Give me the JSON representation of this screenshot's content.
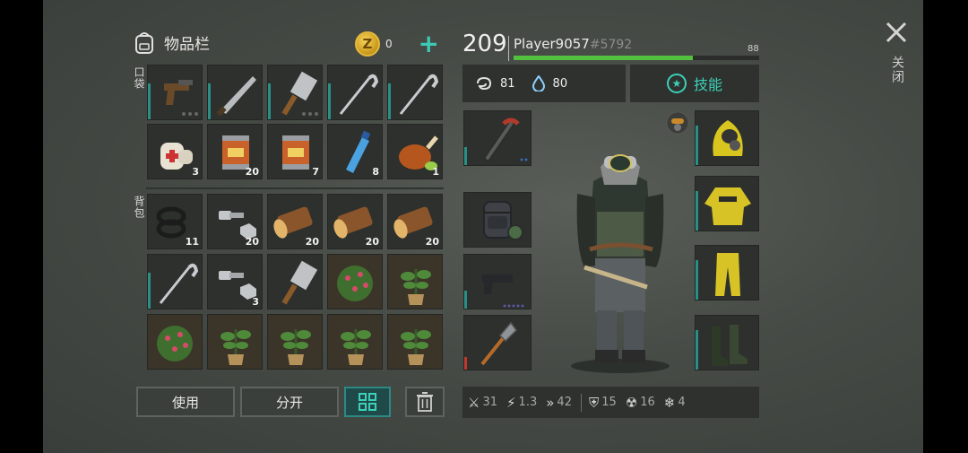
{
  "inventory": {
    "title": "物品栏",
    "coins": "0",
    "pockets_label": "口袋",
    "backpack_label": "背包"
  },
  "pockets": [
    {
      "item": "pistol-crossbow-icon",
      "count": "",
      "dots": true
    },
    {
      "item": "machete-icon",
      "count": "",
      "dots": false
    },
    {
      "item": "cleaver-icon",
      "count": "",
      "dots": true
    },
    {
      "item": "hoe-icon",
      "count": "",
      "dots": false
    },
    {
      "item": "hoe-icon",
      "count": "",
      "dots": false
    },
    {
      "item": "bandage-icon",
      "count": "3",
      "dots": false
    },
    {
      "item": "food-can-icon",
      "count": "20",
      "dots": false
    },
    {
      "item": "food-can-icon",
      "count": "7",
      "dots": false
    },
    {
      "item": "water-bottle-icon",
      "count": "8",
      "dots": false
    },
    {
      "item": "roast-chicken-icon",
      "count": "1",
      "dots": false
    }
  ],
  "backpack": [
    {
      "item": "rubber-rings-icon",
      "count": "11"
    },
    {
      "item": "bolts-icon",
      "count": "20"
    },
    {
      "item": "log-icon",
      "count": "20"
    },
    {
      "item": "log-icon",
      "count": "20"
    },
    {
      "item": "log-icon",
      "count": "20"
    },
    {
      "item": "hoe-icon",
      "count": ""
    },
    {
      "item": "bolts-icon",
      "count": "3"
    },
    {
      "item": "cleaver-icon",
      "count": ""
    },
    {
      "item": "berry-bush-icon",
      "count": ""
    },
    {
      "item": "potted-plant-icon",
      "count": ""
    },
    {
      "item": "berry-bush-icon",
      "count": ""
    },
    {
      "item": "potted-plant-icon",
      "count": ""
    },
    {
      "item": "potted-plant-icon",
      "count": ""
    },
    {
      "item": "potted-plant-icon",
      "count": ""
    },
    {
      "item": "potted-plant-icon",
      "count": ""
    }
  ],
  "buttons": {
    "use": "使用",
    "split": "分开"
  },
  "player": {
    "level": "209",
    "name": "Player9057",
    "tag": "#5792",
    "xp": "88",
    "xp_fraction": 0.73,
    "hunger": "81",
    "thirst": "80",
    "skills_label": "技能"
  },
  "equipment": [
    "crowbar-icon",
    "backpack-icon",
    "pistol-icon",
    "shovel-icon"
  ],
  "armor": [
    "hazmat-hood-icon",
    "hazmat-jacket-icon",
    "hazmat-pants-icon",
    "rubber-boots-icon"
  ],
  "stats": [
    {
      "icon": "attack-icon",
      "value": "31"
    },
    {
      "icon": "attack-speed-icon",
      "value": "1.3"
    },
    {
      "icon": "move-speed-icon",
      "value": "42"
    },
    {
      "icon": "armor-icon",
      "value": "15"
    },
    {
      "icon": "radiation-icon",
      "value": "16"
    },
    {
      "icon": "cold-icon",
      "value": "4"
    }
  ],
  "close_label": "关闭",
  "colors": {
    "accent": "#3cd0b8",
    "xp_bar": "#52c23e",
    "coin": "#e4b93a"
  }
}
